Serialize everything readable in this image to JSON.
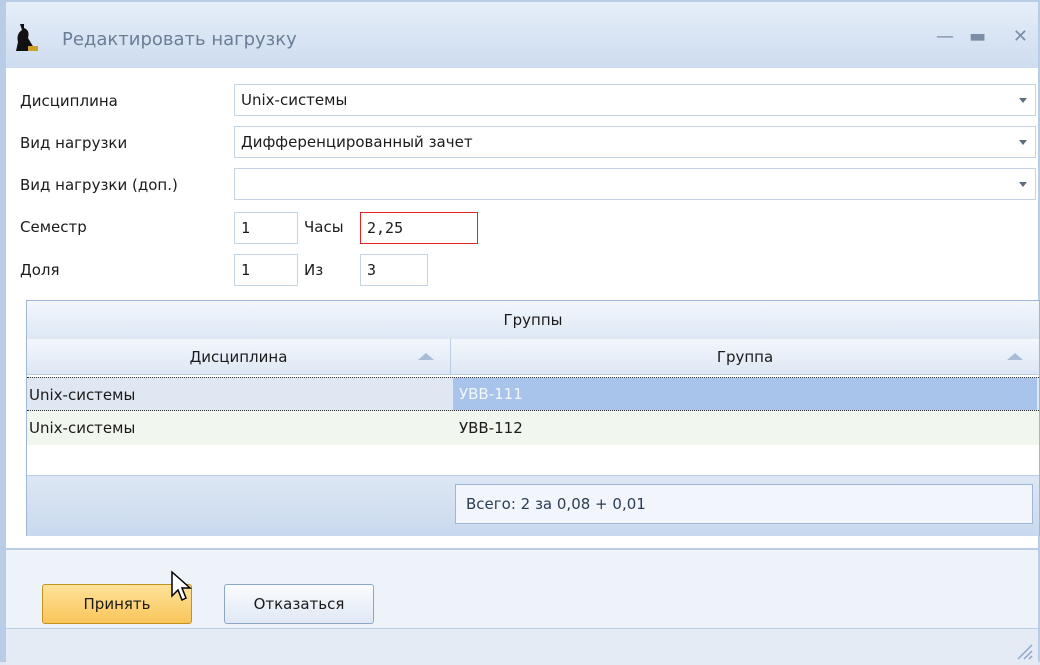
{
  "window": {
    "title": "Редактировать нагрузку"
  },
  "form": {
    "discipline_label": "Дисциплина",
    "discipline_value": "Unix-системы",
    "load_type_label": "Вид нагрузки",
    "load_type_value": "Дифференцированный зачет",
    "load_type_extra_label": "Вид нагрузки (доп.)",
    "load_type_extra_value": "",
    "semester_label": "Семестр",
    "semester_value": "1",
    "hours_label": "Часы",
    "hours_value": "2,25",
    "share_label": "Доля",
    "share_value": "1",
    "of_label": "Из",
    "of_value": "3"
  },
  "groups": {
    "caption": "Группы",
    "columns": [
      "Дисциплина",
      "Группа"
    ],
    "rows": [
      {
        "discipline": "Unix-системы",
        "group": "УВВ-111"
      },
      {
        "discipline": "Unix-системы",
        "group": "УВВ-112"
      }
    ],
    "total": "Всего: 2 за 0,08 + 0,01"
  },
  "buttons": {
    "accept": "Принять",
    "cancel": "Отказаться"
  }
}
